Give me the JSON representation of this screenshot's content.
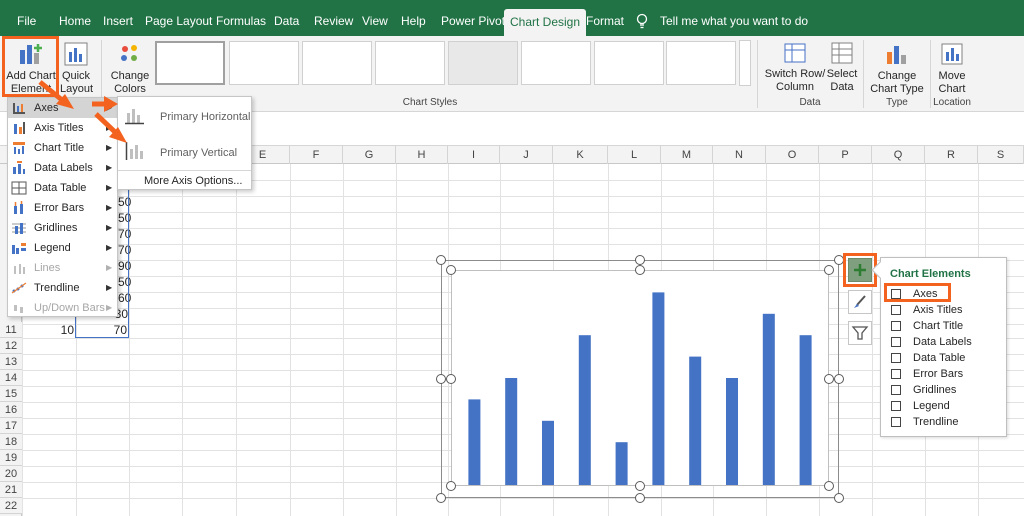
{
  "ribbon_tabs": [
    "File",
    "Home",
    "Insert",
    "Page Layout",
    "Formulas",
    "Data",
    "Review",
    "View",
    "Help",
    "Power Pivot",
    "Chart Design",
    "Format"
  ],
  "active_tab": "Chart Design",
  "tell_me": "Tell me what you want to do",
  "ribbon": {
    "add_chart_element": "Add Chart Element",
    "quick_layout": "Quick Layout",
    "change_colors": "Change Colors",
    "chart_styles": "Chart Styles",
    "switch_row_column": "Switch Row/ Column",
    "select_data": "Select Data",
    "data_group": "Data",
    "change_chart_type": "Change Chart Type",
    "type_group": "Type",
    "move_chart": "Move Chart",
    "location_group": "Location"
  },
  "menu_items": [
    {
      "label": "Axes",
      "disabled": false,
      "highlighted": true
    },
    {
      "label": "Axis Titles",
      "disabled": false,
      "highlighted": false
    },
    {
      "label": "Chart Title",
      "disabled": false,
      "highlighted": false
    },
    {
      "label": "Data Labels",
      "disabled": false,
      "highlighted": false
    },
    {
      "label": "Data Table",
      "disabled": false,
      "highlighted": false
    },
    {
      "label": "Error Bars",
      "disabled": false,
      "highlighted": false
    },
    {
      "label": "Gridlines",
      "disabled": false,
      "highlighted": false
    },
    {
      "label": "Legend",
      "disabled": false,
      "highlighted": false
    },
    {
      "label": "Lines",
      "disabled": true,
      "highlighted": false
    },
    {
      "label": "Trendline",
      "disabled": false,
      "highlighted": false
    },
    {
      "label": "Up/Down Bars",
      "disabled": true,
      "highlighted": false
    }
  ],
  "submenu": {
    "primary_horizontal": "Primary Horizontal",
    "primary_vertical": "Primary Vertical",
    "more_axis_options": "More Axis Options..."
  },
  "columns": [
    "E",
    "F",
    "G",
    "H",
    "I",
    "J",
    "K",
    "L",
    "M",
    "N",
    "O",
    "P",
    "Q",
    "R",
    "S"
  ],
  "rows": [
    "11",
    "12",
    "13",
    "14",
    "15",
    "16",
    "17",
    "18",
    "19",
    "20",
    "21",
    "22"
  ],
  "partial_cells": [
    "50",
    "50",
    "70",
    "70",
    "90",
    "50",
    "60",
    "30"
  ],
  "row11": {
    "a": "10",
    "b": "70"
  },
  "chart_data": {
    "type": "bar",
    "values": [
      40,
      50,
      30,
      70,
      20,
      90,
      60,
      50,
      80,
      70
    ],
    "ylim": [
      0,
      100
    ]
  },
  "chart_elements": {
    "title": "Chart Elements",
    "items": [
      {
        "label": "Axes",
        "checked": false
      },
      {
        "label": "Axis Titles",
        "checked": false
      },
      {
        "label": "Chart Title",
        "checked": false
      },
      {
        "label": "Data Labels",
        "checked": false
      },
      {
        "label": "Data Table",
        "checked": false
      },
      {
        "label": "Error Bars",
        "checked": false
      },
      {
        "label": "Gridlines",
        "checked": false
      },
      {
        "label": "Legend",
        "checked": false
      },
      {
        "label": "Trendline",
        "checked": false
      }
    ]
  },
  "colors": {
    "brand": "#217346",
    "accent_orange": "#f4621f",
    "bar": "#4472c4",
    "panel_title": "#217346"
  }
}
